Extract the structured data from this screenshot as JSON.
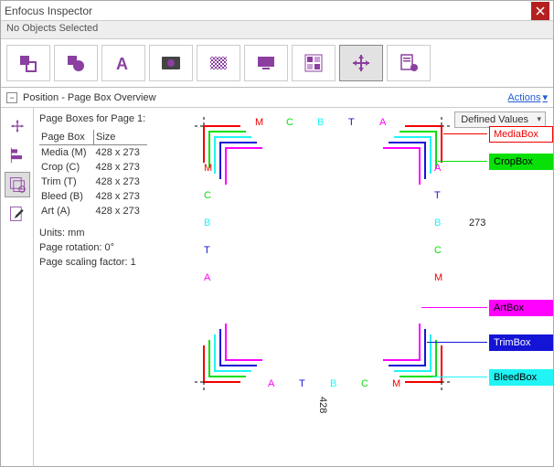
{
  "window": {
    "title": "Enfocus Inspector"
  },
  "status": {
    "text": "No Objects Selected"
  },
  "toolbar": {
    "items": [
      {
        "name": "fill-stroke-tool"
      },
      {
        "name": "shapes-tool"
      },
      {
        "name": "text-tool"
      },
      {
        "name": "image-tool"
      },
      {
        "name": "transparency-tool"
      },
      {
        "name": "screen-tool"
      },
      {
        "name": "separations-tool"
      },
      {
        "name": "position-tool"
      },
      {
        "name": "prepress-tool"
      }
    ]
  },
  "section": {
    "title": "Position - Page Box Overview",
    "actions_label": "Actions"
  },
  "dropdown": {
    "selected": "Defined Values"
  },
  "pageboxes": {
    "heading": "Page Boxes for Page 1:",
    "headers": {
      "box": "Page Box",
      "size": "Size"
    },
    "rows": [
      {
        "label": "Media (M)",
        "size": "428 x 273"
      },
      {
        "label": "Crop (C)",
        "size": "428 x 273"
      },
      {
        "label": "Trim (T)",
        "size": "428 x 273"
      },
      {
        "label": "Bleed (B)",
        "size": "428 x 273"
      },
      {
        "label": "Art (A)",
        "size": "428 x 273"
      }
    ],
    "units_line": "Units: mm",
    "rotation_line": "Page rotation: 0°",
    "scaling_line": "Page scaling factor: 1"
  },
  "diagram": {
    "letters": {
      "M": "M",
      "C": "C",
      "B": "B",
      "T": "T",
      "A": "A"
    },
    "width_label": "428",
    "height_label": "273"
  },
  "callouts": {
    "media": {
      "label": "MediaBox",
      "bg": "#ffffff",
      "fg": "#f00000",
      "border": "#f00000"
    },
    "crop": {
      "label": "CropBox",
      "bg": "#08e008",
      "fg": "#000000",
      "border": "#08e008"
    },
    "art": {
      "label": "ArtBox",
      "bg": "#ff00ff",
      "fg": "#000000",
      "border": "#ff00ff"
    },
    "trim": {
      "label": "TrimBox",
      "bg": "#1414d6",
      "fg": "#ffffff",
      "border": "#1414d6"
    },
    "bleed": {
      "label": "BleedBox",
      "bg": "#20f4f4",
      "fg": "#000000",
      "border": "#20f4f4"
    }
  },
  "colors": {
    "media": "#f00000",
    "crop": "#08e008",
    "trim": "#1414d6",
    "bleed": "#20f4f4",
    "art": "#ff00ff"
  }
}
